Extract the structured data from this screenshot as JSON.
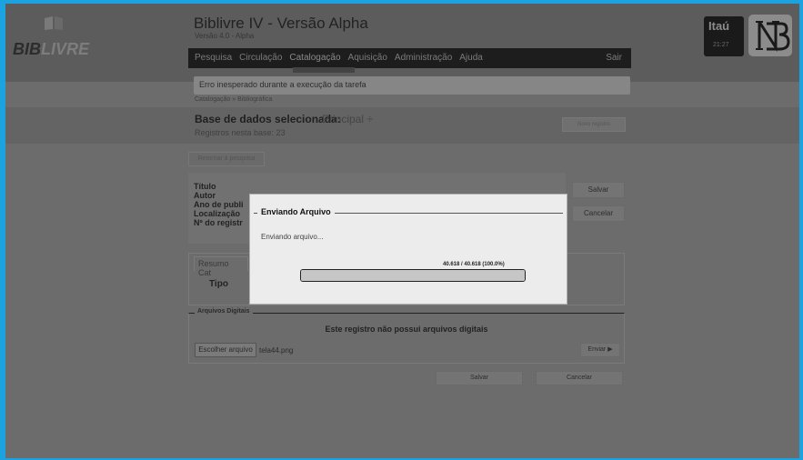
{
  "header": {
    "logo_text_a": "BIB",
    "logo_text_b": "LIVRE",
    "title": "Biblivre IV - Versão Alpha",
    "version": "Versão 4.0 - Alpha"
  },
  "menu": {
    "items": [
      "Pesquisa",
      "Circulação",
      "Catalogação",
      "Aquisição",
      "Administração",
      "Ajuda"
    ],
    "active_index": 2,
    "logout": "Sair"
  },
  "bank": {
    "name": "Itaú",
    "time": "21:27"
  },
  "error": {
    "message": "Erro inesperado durante a execução da tarefa"
  },
  "breadcrumb": "Catalogação » Bibliográfica",
  "database": {
    "label": "Base de dados selecionada:",
    "value": "Principal ÷",
    "count": "Registros nesta base: 23",
    "new_record": "Novo registro"
  },
  "back_button": "Retornar à pesquisa",
  "fields": [
    "Título",
    "Autor",
    "Ano de publi",
    "Localização",
    "Nº do registr"
  ],
  "side_buttons": {
    "save": "Salvar",
    "cancel": "Cancelar"
  },
  "summary": {
    "tab": "Resumo Cat",
    "type_label": "Tipo"
  },
  "digital": {
    "legend": "Arquivos Digitais",
    "message": "Este registro não possui arquivos digitais",
    "choose": "Escolher arquivo",
    "file": "tela44.png",
    "send": "Enviar ▶"
  },
  "bottom_buttons": {
    "save": "Salvar",
    "cancel": "Cancelar"
  },
  "modal": {
    "title": "Enviando Arquivo",
    "message": "Enviando arquivo...",
    "progress_text": "40.618 / 40.618 (100.0%)",
    "progress": 1.0
  }
}
